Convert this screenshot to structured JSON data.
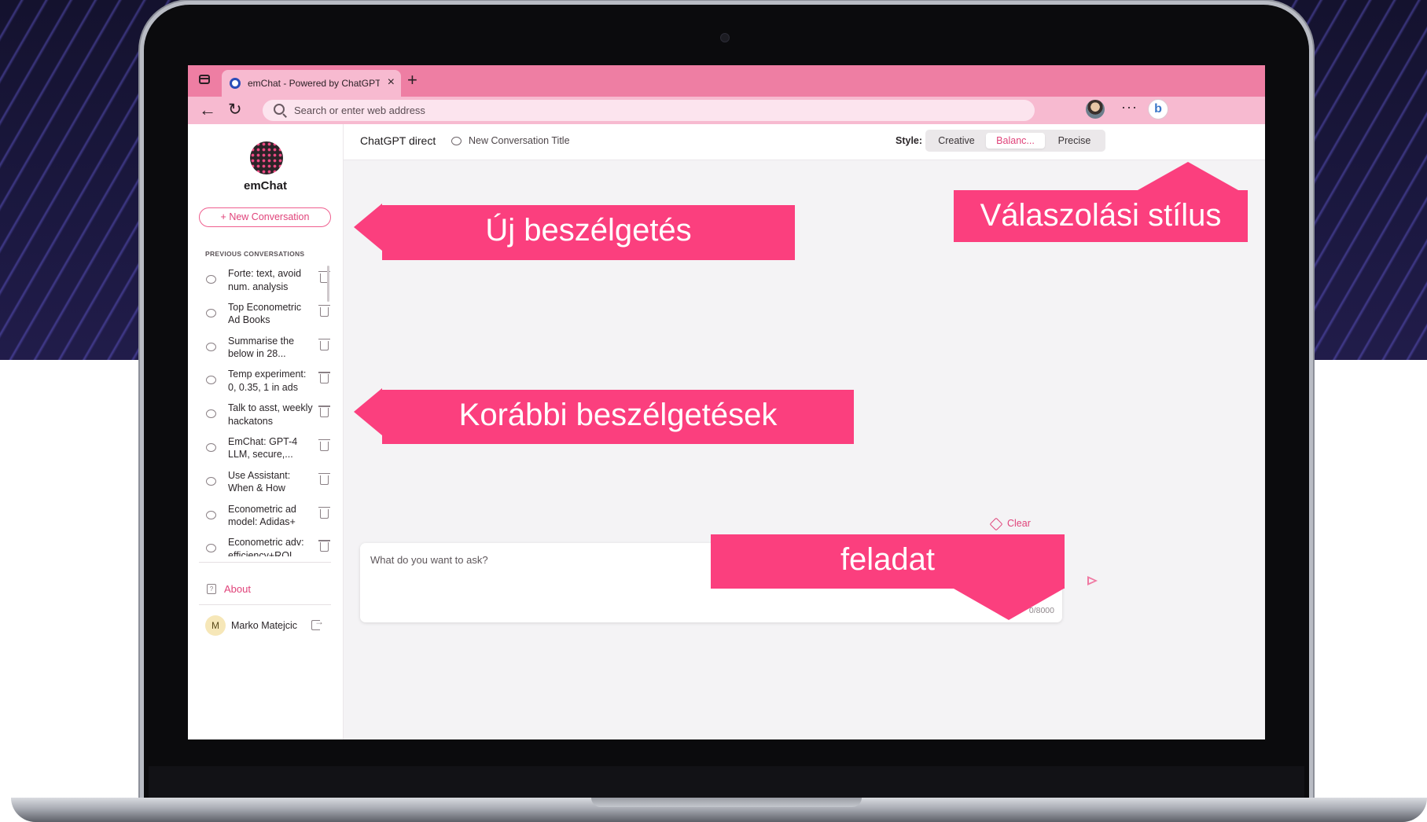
{
  "browser": {
    "tab_title": "emChat - Powered by ChatGPT",
    "tab_close": "×",
    "new_tab": "+",
    "back": "←",
    "reload": "↻",
    "address_placeholder": "Search or enter web address",
    "more": "···",
    "bing": "b"
  },
  "sidebar": {
    "brand": "emChat",
    "new_conversation": "+ New Conversation",
    "previous_title": "PREVIOUS CONVERSATIONS",
    "conversations": [
      "Forte: text, avoid num. analysis",
      "Top Econometric Ad Books",
      "Summarise the below in 28...",
      "Temp experiment: 0, 0.35, 1 in ads",
      "Talk to asst, weekly hackatons",
      "EmChat: GPT-4 LLM, secure,...",
      "Use Assistant: When & How",
      "Econometric ad model: Adidas+",
      "Econometric adv: efficiency+ROI"
    ],
    "about": "About",
    "about_icon": "?",
    "user_initial": "M",
    "user_name": "Marko Matejcic"
  },
  "topbar": {
    "mode": "ChatGPT direct",
    "conversation_title": "New Conversation Title",
    "style_label": "Style:",
    "styles": [
      "Creative",
      "Balanc...",
      "Precise"
    ],
    "active_style": "Balanc..."
  },
  "composer": {
    "clear": "Clear",
    "placeholder": "What do you want to ask?",
    "char_count": "0/8000"
  },
  "annotations": {
    "new_conversation": "Új beszélgetés",
    "response_style": "Válaszolási stílus",
    "previous_conversations": "Korábbi beszélgetések",
    "task": "feladat"
  },
  "colors": {
    "accent": "#e0437a",
    "callout": "#fb3f7e",
    "browser_chrome": "#ee7ea3"
  }
}
